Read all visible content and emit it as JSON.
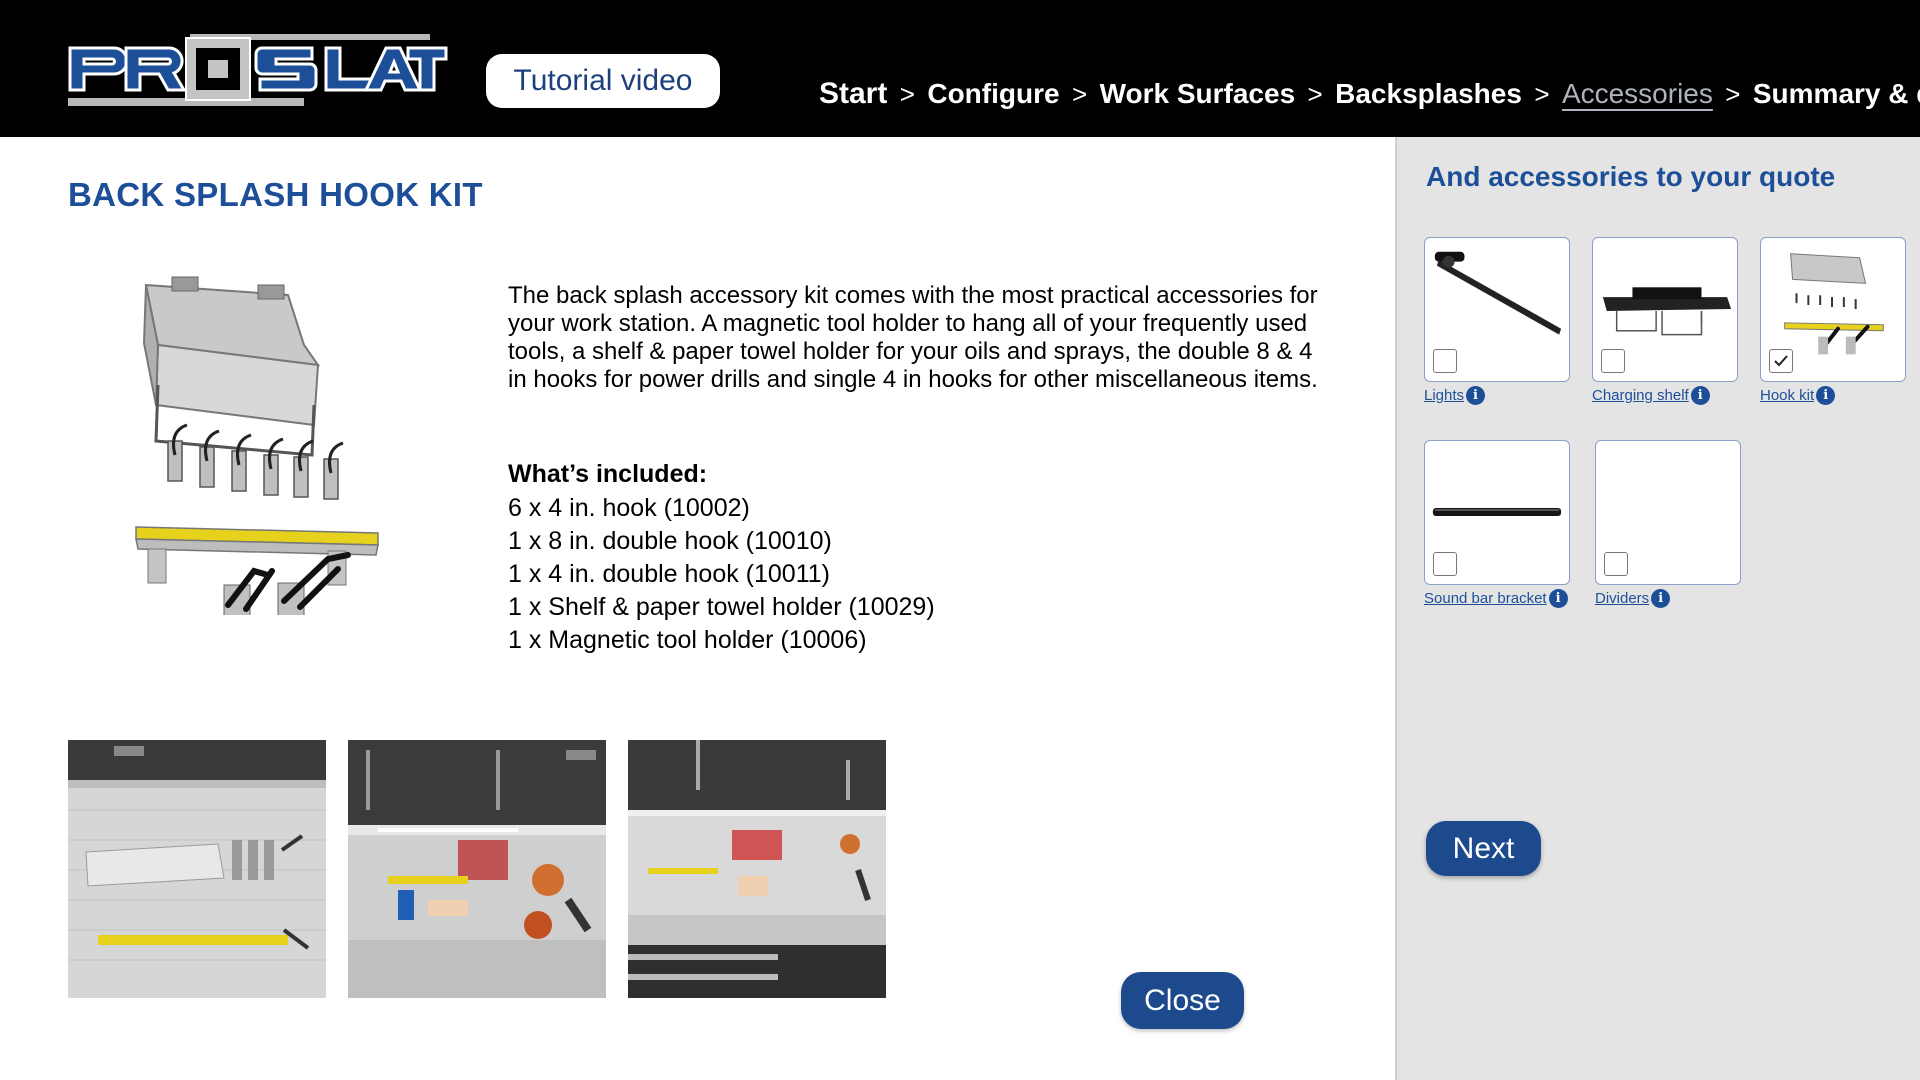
{
  "header": {
    "logo_text": "PROSLAT",
    "tutorial_label": "Tutorial video",
    "breadcrumbs": [
      {
        "label": "Start"
      },
      {
        "label": "Configure"
      },
      {
        "label": "Work Surfaces"
      },
      {
        "label": "Backsplashes"
      },
      {
        "label": "Accessories"
      },
      {
        "label": "Summary & quote"
      }
    ],
    "separator": ">",
    "active_crumb": "Accessories"
  },
  "main": {
    "title": "BACK SPLASH HOOK KIT",
    "description": "The back splash accessory kit comes with the most practical accessories for your work station. A magnetic tool holder to hang all of your frequently used tools, a shelf & paper towel holder for your oils and sprays, the double 8 & 4 in hooks for power drills and single 4 in hooks for other miscellaneous items.",
    "included_title": "What’s included:",
    "included_items": [
      "6 x 4 in. hook (10002)",
      "1 x 8 in. double hook (10010)",
      "1 x 4 in. double hook (10011)",
      "1 x Shelf & paper towel holder (10029)",
      "1 x Magnetic tool holder (10006)"
    ],
    "close_label": "Close"
  },
  "sidebar": {
    "title": "And accessories to your quote",
    "items": [
      {
        "label": "Lights",
        "checked": false,
        "icon": "light-bar-icon"
      },
      {
        "label": "Charging shelf",
        "checked": false,
        "icon": "charging-shelf-icon"
      },
      {
        "label": "Hook kit",
        "checked": true,
        "icon": "hook-kit-icon"
      },
      {
        "label": "Sound bar bracket",
        "checked": false,
        "icon": "sound-bar-icon"
      },
      {
        "label": "Dividers",
        "checked": false,
        "icon": ""
      }
    ],
    "info_glyph": "i",
    "next_label": "Next"
  },
  "colors": {
    "header_bg": "#000000",
    "brand_blue": "#1d4f99",
    "button_blue": "#1d4a8d",
    "sidebar_bg": "#e4e4e4",
    "accent_yellow": "#e6d21c"
  }
}
